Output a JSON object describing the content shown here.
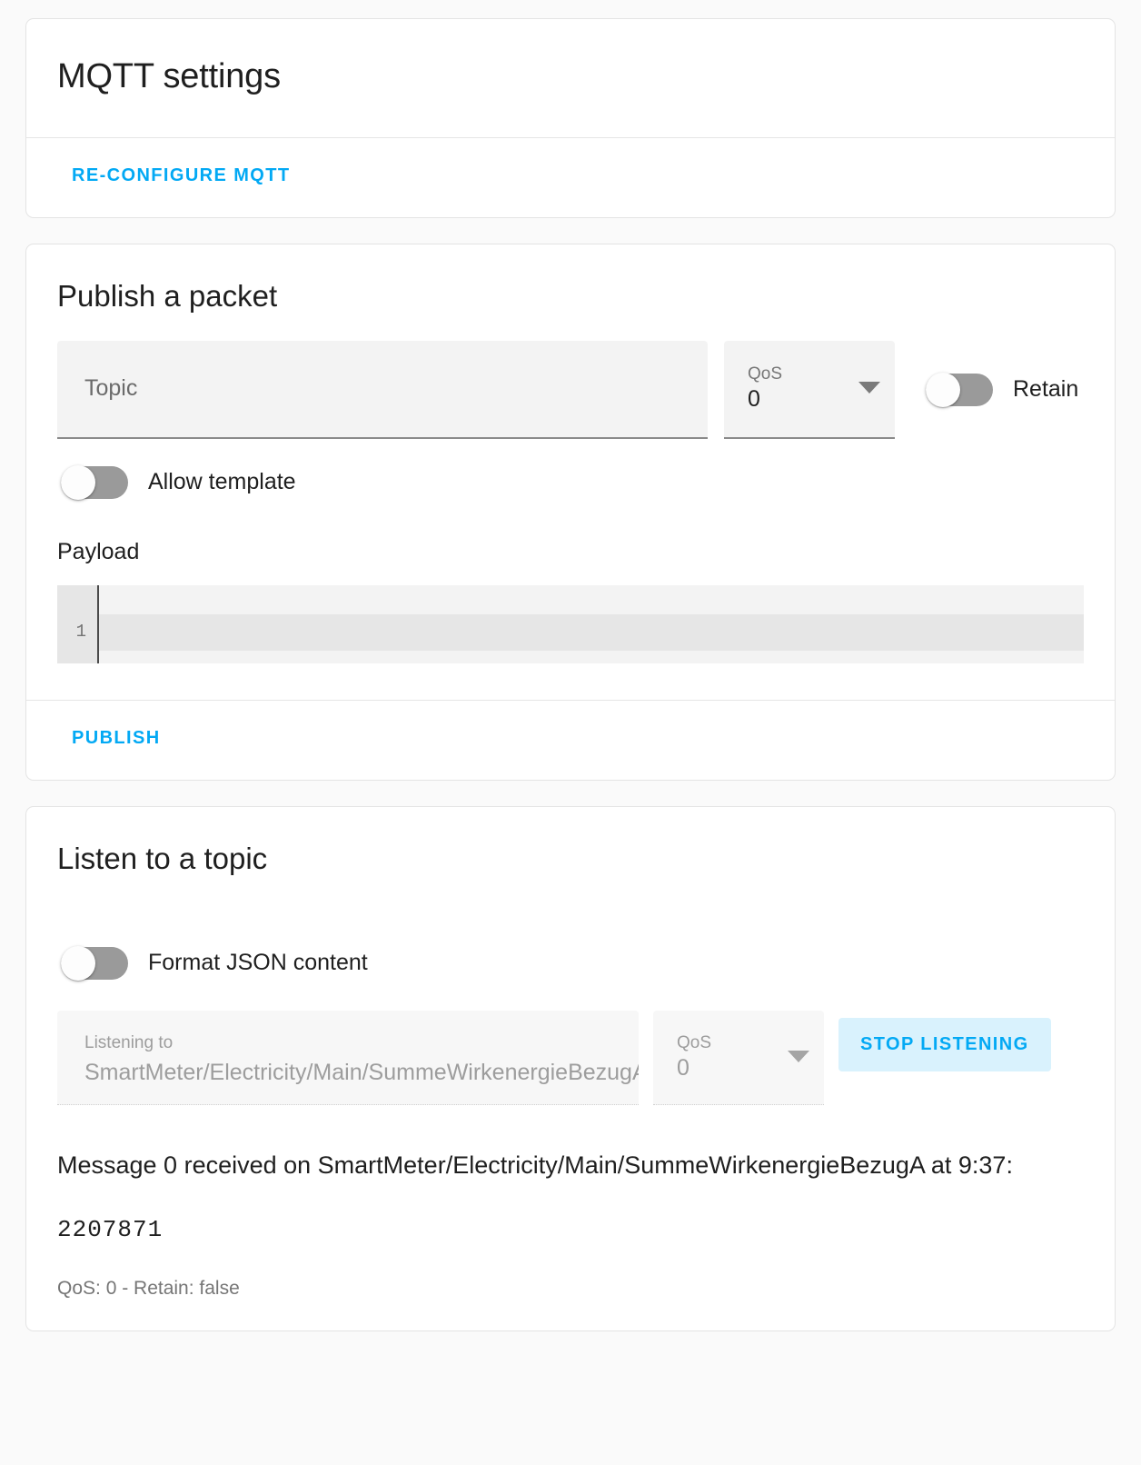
{
  "settings_card": {
    "title": "MQTT settings",
    "reconfigure_label": "RE-CONFIGURE MQTT"
  },
  "publish_card": {
    "heading": "Publish a packet",
    "topic": {
      "placeholder": "Topic",
      "value": ""
    },
    "qos": {
      "label": "QoS",
      "value": "0"
    },
    "retain": {
      "label": "Retain",
      "state": "off"
    },
    "allow_template": {
      "label": "Allow template",
      "state": "off"
    },
    "payload": {
      "label": "Payload",
      "line_number": "1",
      "content": ""
    },
    "publish_label": "PUBLISH"
  },
  "listen_card": {
    "heading": "Listen to a topic",
    "format_json": {
      "label": "Format JSON content",
      "state": "off"
    },
    "listening_to": {
      "label": "Listening to",
      "value": "SmartMeter/Electricity/Main/SummeWirkenergieBezugA"
    },
    "qos": {
      "label": "QoS",
      "value": "0"
    },
    "stop_label": "STOP LISTENING",
    "message": {
      "header": "Message 0 received on SmartMeter/Electricity/Main/SummeWirkenergieBezugA at 9:37:",
      "payload": "2207871",
      "meta": "QoS: 0 - Retain: false"
    }
  },
  "colors": {
    "accent": "#03a9f4",
    "tonal_button_bg": "#d9f2fd",
    "page_bg": "#fafafa",
    "card_bg": "#ffffff"
  }
}
